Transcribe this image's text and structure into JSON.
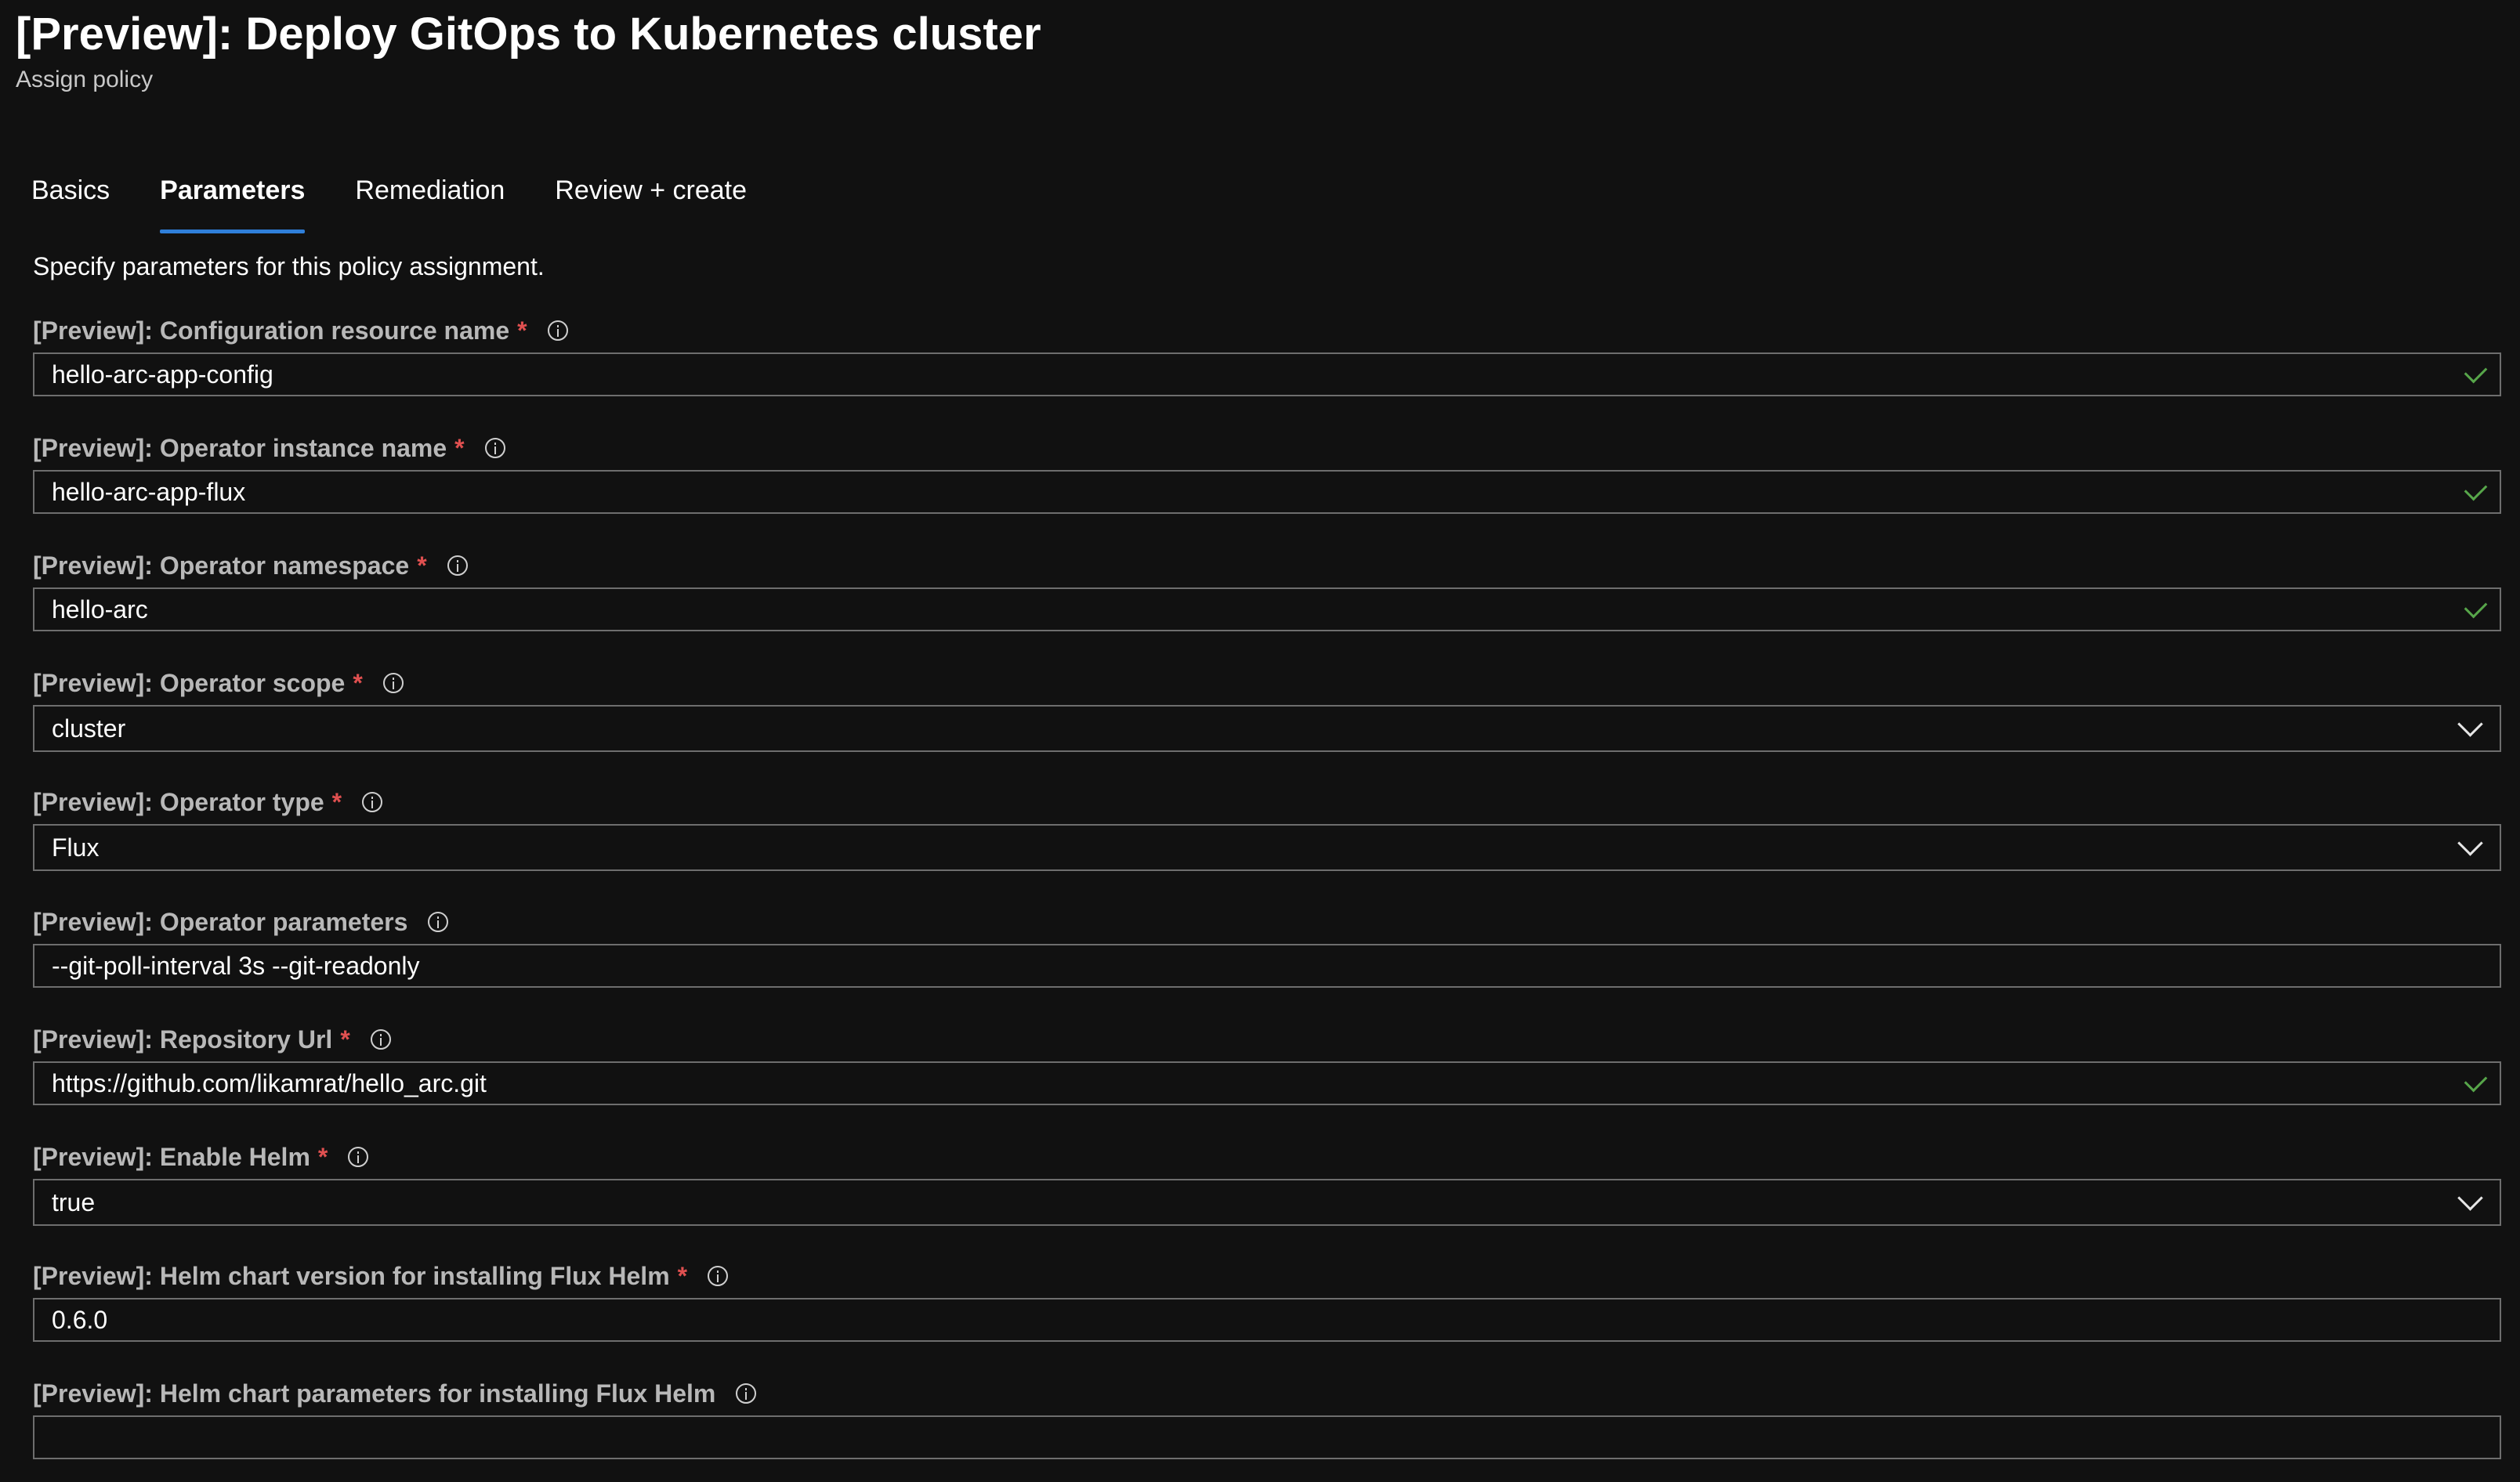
{
  "header": {
    "title": "[Preview]: Deploy GitOps to Kubernetes cluster",
    "subtitle": "Assign policy"
  },
  "tabs": [
    {
      "label": "Basics"
    },
    {
      "label": "Parameters"
    },
    {
      "label": "Remediation"
    },
    {
      "label": "Review + create"
    }
  ],
  "intro": "Specify parameters for this policy assignment.",
  "required_mark": "*",
  "fields": [
    {
      "label": "[Preview]: Configuration resource name",
      "value": "hello-arc-app-config"
    },
    {
      "label": "[Preview]: Operator instance name",
      "value": "hello-arc-app-flux"
    },
    {
      "label": "[Preview]: Operator namespace",
      "value": "hello-arc"
    },
    {
      "label": "[Preview]: Operator scope",
      "value": "cluster"
    },
    {
      "label": "[Preview]: Operator type",
      "value": "Flux"
    },
    {
      "label": "[Preview]: Operator parameters",
      "value": "--git-poll-interval 3s --git-readonly"
    },
    {
      "label": "[Preview]: Repository Url",
      "value": "https://github.com/likamrat/hello_arc.git"
    },
    {
      "label": "[Preview]: Enable Helm",
      "value": "true"
    },
    {
      "label": "[Preview]: Helm chart version for installing Flux Helm",
      "value": "0.6.0"
    },
    {
      "label": "[Preview]: Helm chart parameters for installing Flux Helm",
      "value": ""
    }
  ],
  "colors": {
    "background": "#111111",
    "accent": "#2f7fd9",
    "required": "#e05050",
    "valid": "#57a64a"
  }
}
